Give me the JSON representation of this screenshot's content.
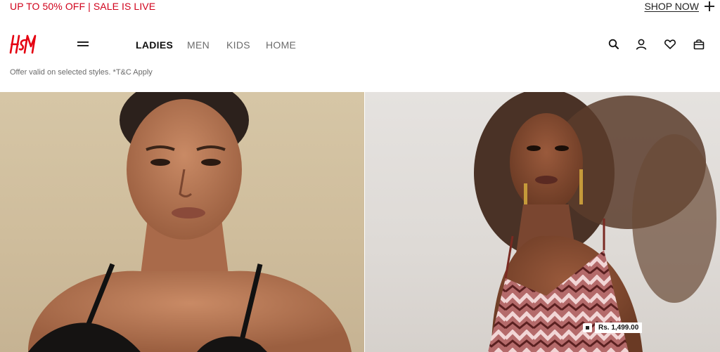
{
  "promo": {
    "text": "UP TO 50% OFF | SALE IS LIVE",
    "cta_label": "SHOP NOW",
    "cta_icon": "plus-icon",
    "text_color": "#d0021b"
  },
  "header": {
    "logo_text": "H&M",
    "logo_color": "#e50010",
    "menu_icon": "hamburger-icon",
    "nav": [
      {
        "label": "LADIES",
        "active": true
      },
      {
        "label": "MEN",
        "active": false
      },
      {
        "label": "KIDS",
        "active": false
      },
      {
        "label": "HOME",
        "active": false
      }
    ],
    "icons": [
      "search-icon",
      "account-icon",
      "favorites-icon",
      "shopping-bag-icon"
    ]
  },
  "offer_note": "Offer valid on selected styles. *T&C Apply",
  "hero": {
    "left_image": "model-black-top-photo",
    "right_image": "model-printed-dress-photo",
    "price_tag": "Rs. 1,499.00"
  }
}
